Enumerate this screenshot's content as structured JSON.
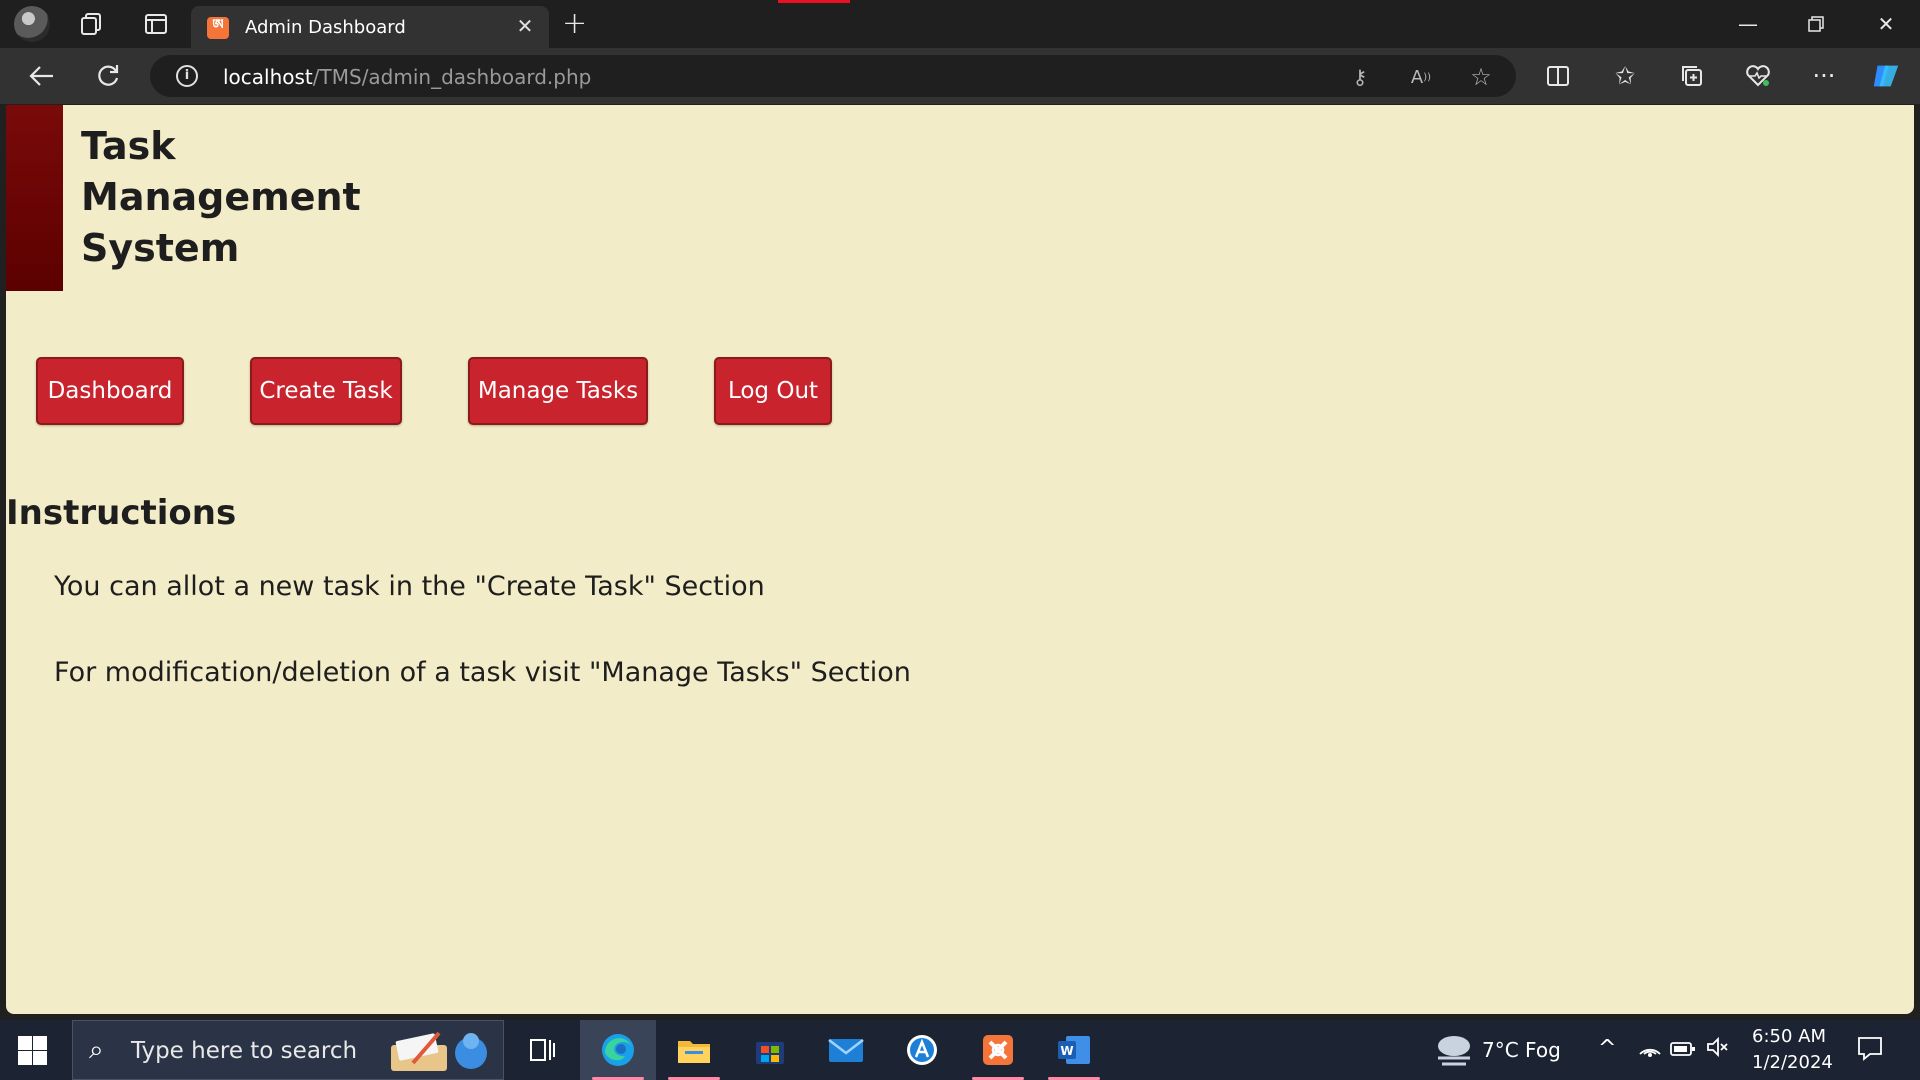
{
  "browser": {
    "tab_title": "Admin Dashboard",
    "tab_favicon": "xampp-icon",
    "url_host": "localhost",
    "url_path": "/TMS/admin_dashboard.php"
  },
  "page": {
    "site_title_lines": [
      "Task",
      "Management",
      "System"
    ],
    "nav_buttons": [
      "Dashboard",
      "Create Task",
      "Manage Tasks",
      "Log Out"
    ],
    "heading": "Instructions",
    "instructions": [
      "You can allot a new task in the \"Create Task\" Section",
      "For modification/deletion of a task visit \"Manage Tasks\" Section"
    ],
    "colors": {
      "background": "#f3ecc8",
      "accent_bar": "#6b0505",
      "button": "#c9232e"
    }
  },
  "taskbar": {
    "search_placeholder": "Type here to search",
    "weather": "7°C  Fog",
    "time": "6:50 AM",
    "date": "1/2/2024"
  }
}
